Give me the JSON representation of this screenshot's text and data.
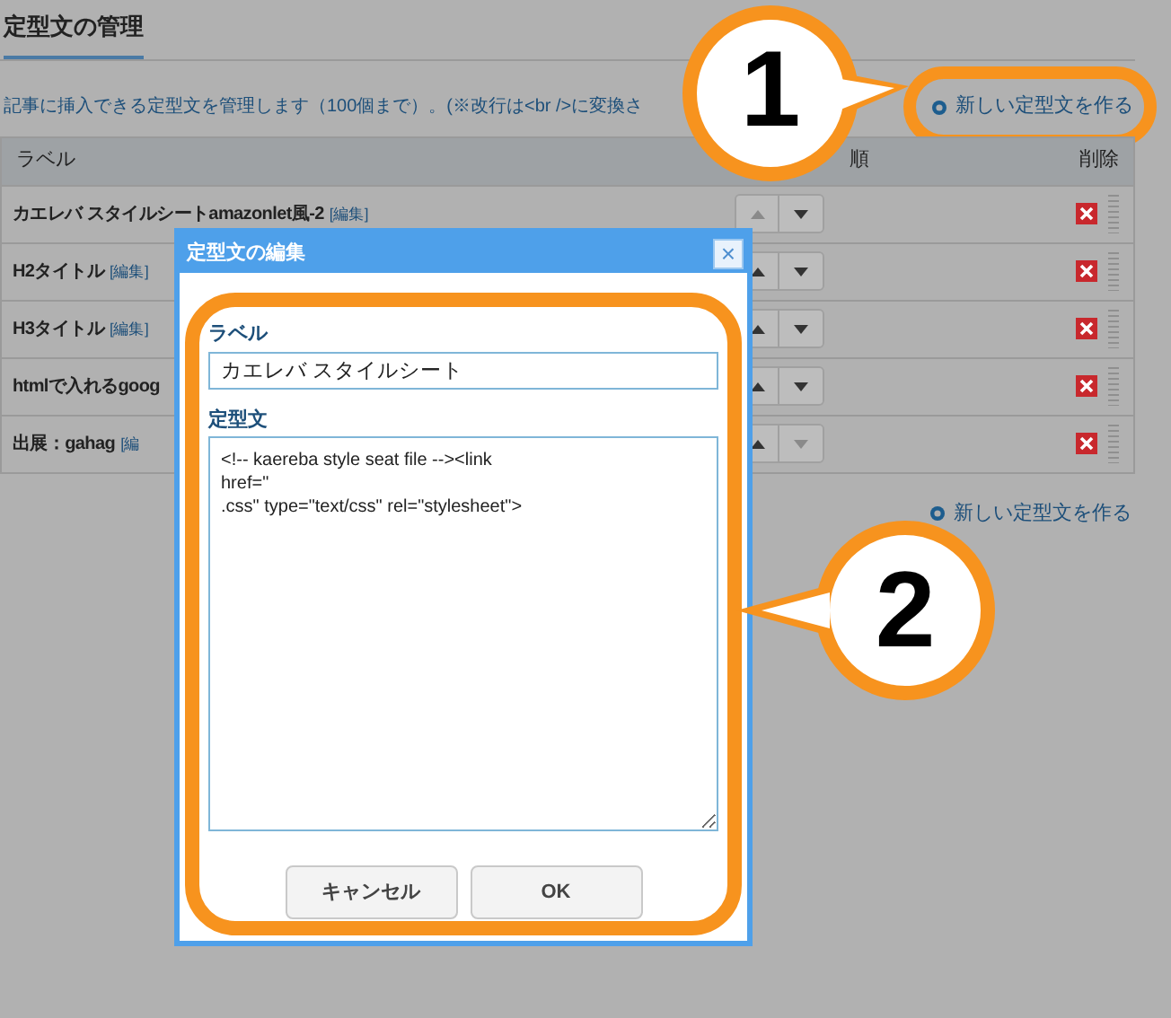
{
  "page_title": "定型文の管理",
  "description": "記事に挿入できる定型文を管理します（100個まで）。(※改行は<br />に変換さ",
  "new_link_top": "新しい定型文を作る",
  "table": {
    "columns": [
      "ラベル",
      "順",
      "削除"
    ],
    "rows": [
      {
        "label": "カエレバ スタイルシートamazonlet風-2",
        "edit": "[編集]",
        "up_disabled": true,
        "down_disabled": false
      },
      {
        "label": "H2タイトル",
        "edit": "[編集]",
        "up_disabled": false,
        "down_disabled": false
      },
      {
        "label": "H3タイトル",
        "edit": "[編集]",
        "up_disabled": false,
        "down_disabled": false
      },
      {
        "label": "htmlで入れるgoog",
        "up_disabled": false,
        "down_disabled": false
      },
      {
        "label": "出展：gahag",
        "edit": "[編",
        "up_disabled": false,
        "down_disabled": true
      }
    ]
  },
  "new_link_bottom": "新しい定型文を作る",
  "dialog": {
    "title": "定型文の編集",
    "close": "×",
    "label_caption": "ラベル",
    "label_value": "カエレバ スタイルシート",
    "body_caption": "定型文",
    "body_value": "<!-- kaereba style seat file --><link\nhref=\"\n.css\" type=\"text/css\" rel=\"stylesheet\">",
    "buttons": [
      "キャンセル",
      "OK"
    ]
  },
  "callouts": [
    {
      "label": "1"
    },
    {
      "label": "2"
    }
  ]
}
